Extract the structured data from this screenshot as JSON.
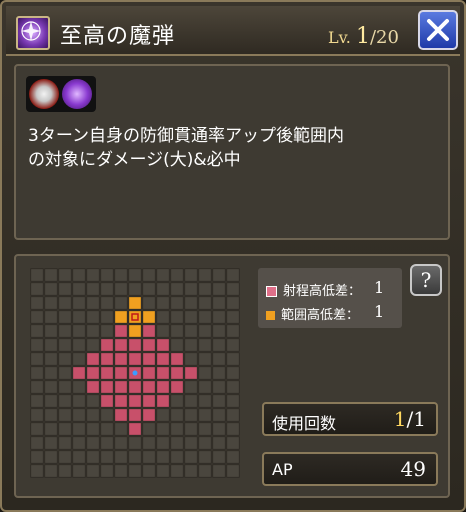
{
  "header": {
    "title": "至高の魔弾",
    "level_prefix": "Lv.",
    "level_current": "1",
    "level_max": "/20",
    "skill_icon": "purple-star-sigil-icon",
    "close_icon": "close-x-icon"
  },
  "description": {
    "attribute_icons": [
      "slash-attack-icon",
      "dark-orb-icon"
    ],
    "text_line1": "3ターン自身の防御貫通率アップ後範囲内",
    "text_line2": "の対象にダメージ(大)&必中"
  },
  "range": {
    "legend": [
      {
        "label": "射程高低差：",
        "value": "1",
        "color": "#e0708a"
      },
      {
        "label": "範囲高低差：",
        "value": "1",
        "color": "#f0a020"
      }
    ],
    "help_label": "?",
    "grid_size": 15,
    "range_color": "#c8506a",
    "area_color": "#f0a020",
    "center_marker_color": "#3a9cff"
  },
  "stats": {
    "uses_label": "使用回数",
    "uses_current": "1",
    "uses_max": "/1",
    "ap_label": "AP",
    "ap_value": "49"
  }
}
